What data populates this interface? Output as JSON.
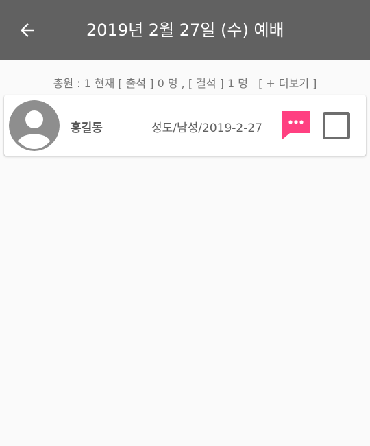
{
  "appbar": {
    "title": "2019년 2월 27일 (수) 예배",
    "back_icon": "arrow-left-icon",
    "background_color": "#616161"
  },
  "summary": {
    "text": "총원 : 1 현재 [ 출석 ] 0 명 , [ 결석 ] 1 명",
    "more_label": "[ + 더보기 ]"
  },
  "members": [
    {
      "name": "홍길동",
      "info": "성도/남성/2019-2-27",
      "avatar_icon": "person-avatar-icon",
      "message_icon": "chat-bubble-icon",
      "message_color": "#ff4081",
      "checked": false
    }
  ]
}
